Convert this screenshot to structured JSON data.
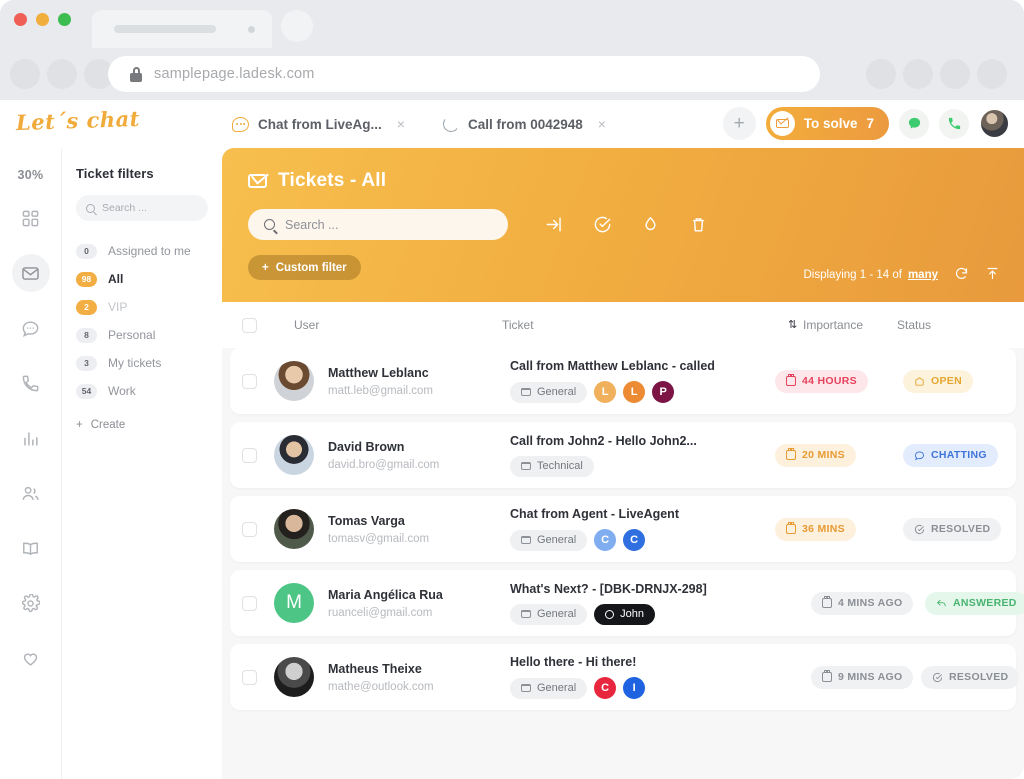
{
  "browser": {
    "url": "samplepage.ladesk.com",
    "lock_icon": "lock-icon",
    "traffic_lights": [
      "close",
      "minimize",
      "maximize"
    ]
  },
  "appbar": {
    "logo": "Let´s chat",
    "tabs": [
      {
        "label": "Chat from LiveAg...",
        "icon": "chat-bubble-icon",
        "close": "×"
      },
      {
        "label": "Call from 0042948",
        "icon": "phone-icon",
        "close": "×"
      }
    ],
    "add_label": "+",
    "to_solve_label": "To solve",
    "to_solve_count": "7",
    "chat_icon": "chat-green-icon",
    "call_icon": "phone-green-icon",
    "avatar": "user-avatar"
  },
  "rail": {
    "percent": "30%",
    "items": [
      {
        "name": "dashboard-icon"
      },
      {
        "name": "tickets-icon"
      },
      {
        "name": "chats-icon"
      },
      {
        "name": "calls-icon"
      },
      {
        "name": "reports-icon"
      },
      {
        "name": "customers-icon"
      },
      {
        "name": "knowledge-base-icon"
      },
      {
        "name": "settings-icon"
      },
      {
        "name": "favorites-icon"
      }
    ]
  },
  "filters": {
    "title": "Ticket filters",
    "search_placeholder": "Search ...",
    "items": [
      {
        "count": "0",
        "label": "Assigned to me",
        "state": "normal"
      },
      {
        "count": "98",
        "label": "All",
        "state": "selected"
      },
      {
        "count": "2",
        "label": "VIP",
        "state": "muted"
      },
      {
        "count": "8",
        "label": "Personal",
        "state": "normal"
      },
      {
        "count": "3",
        "label": "My tickets",
        "state": "normal"
      },
      {
        "count": "54",
        "label": "Work",
        "state": "normal"
      }
    ],
    "create_label": "Create"
  },
  "panel": {
    "title": "Tickets - All",
    "title_icon": "envelope-icon",
    "search_placeholder": "Search ...",
    "actions": [
      {
        "name": "transfer-icon"
      },
      {
        "name": "resolve-icon"
      },
      {
        "name": "spam-icon"
      },
      {
        "name": "delete-icon"
      }
    ],
    "displaying_text": "Displaying 1 - 14 of",
    "displaying_link": "many",
    "refresh_icon": "refresh-icon",
    "export_icon": "export-icon",
    "custom_filter_label": "Custom filter"
  },
  "table": {
    "columns": {
      "user": "User",
      "ticket": "Ticket",
      "importance": "Importance",
      "status": "Status"
    },
    "sort_icon": "sort-icon",
    "rows": [
      {
        "avatar_class": "a1",
        "avatar_letter": "",
        "name": "Matthew Leblanc",
        "email": "matt.leb@gmail.com",
        "subject": "Call from Matthew Leblanc - called",
        "department": "General",
        "bubbles": [
          {
            "letter": "L",
            "color": "#f0b05c"
          },
          {
            "letter": "L",
            "color": "#ec8b34"
          },
          {
            "letter": "P",
            "color": "#7d1446"
          }
        ],
        "importance": "44 HOURS",
        "importance_bg": "#fde7ea",
        "importance_fg": "#e8415c",
        "status": "OPEN",
        "status_bg": "#fdf3dd",
        "status_fg": "#e5a52f",
        "status_icon": "open-icon"
      },
      {
        "avatar_class": "a2",
        "avatar_letter": "",
        "name": "David Brown",
        "email": "david.bro@gmail.com",
        "subject": "Call from John2 - Hello John2...",
        "department": "Technical",
        "bubbles": [],
        "importance": "20 MINS",
        "importance_bg": "#fdf0dd",
        "importance_fg": "#e79b33",
        "status": "CHATTING",
        "status_bg": "#e2ecfd",
        "status_fg": "#3f74d8",
        "status_icon": "chatting-icon"
      },
      {
        "avatar_class": "a3",
        "avatar_letter": "",
        "name": "Tomas Varga",
        "email": "tomasv@gmail.com",
        "subject": "Chat from Agent - LiveAgent",
        "department": "General",
        "bubbles": [
          {
            "letter": "C",
            "color": "#7fadf0"
          },
          {
            "letter": "C",
            "color": "#2f6fe0"
          }
        ],
        "importance": "36 MINS",
        "importance_bg": "#fdf0dd",
        "importance_fg": "#e79b33",
        "status": "RESOLVED",
        "status_bg": "#f0f1f3",
        "status_fg": "#8b8e94",
        "status_icon": "resolved-icon"
      },
      {
        "avatar_class": "a4",
        "avatar_letter": "M",
        "name": "Maria Angélica Rua",
        "email": "ruanceli@gmail.com",
        "subject": "What's Next? - [DBK-DRNJX-298]",
        "department": "General",
        "assignee": "John",
        "bubbles": [],
        "importance": "4 MINS AGO",
        "importance_bg": "#f0f1f3",
        "importance_fg": "#8b8e94",
        "status": "ANSWERED",
        "status_bg": "#e4f7ea",
        "status_fg": "#49b36f",
        "status_icon": "answered-icon"
      },
      {
        "avatar_class": "a5",
        "avatar_letter": "",
        "name": "Matheus Theixe",
        "email": "mathe@outlook.com",
        "subject": "Hello there - Hi there!",
        "department": "General",
        "bubbles": [
          {
            "letter": "C",
            "color": "#e8273f"
          },
          {
            "letter": "I",
            "color": "#1f63e0"
          }
        ],
        "importance": "9 MINS AGO",
        "importance_bg": "#f0f1f3",
        "importance_fg": "#8b8e94",
        "status": "RESOLVED",
        "status_bg": "#f0f1f3",
        "status_fg": "#8b8e94",
        "status_icon": "resolved-icon"
      }
    ]
  }
}
